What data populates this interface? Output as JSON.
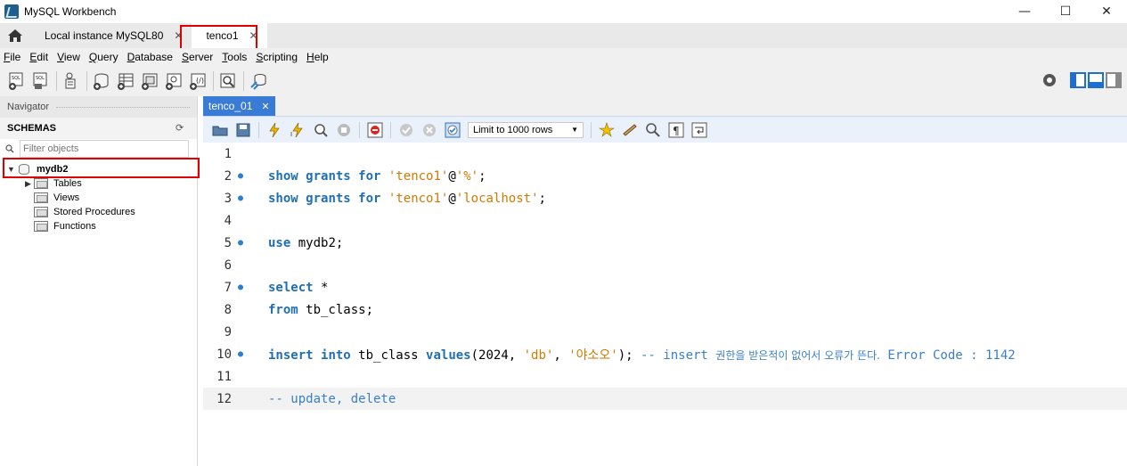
{
  "window": {
    "title": "MySQL Workbench",
    "minimize": "—",
    "maximize": "☐",
    "close": "✕"
  },
  "connection_tabs": [
    {
      "label": "Local instance MySQL80",
      "close": "✕"
    },
    {
      "label": "tenco1",
      "close": "✕"
    }
  ],
  "menu": [
    {
      "label": "File"
    },
    {
      "label": "Edit"
    },
    {
      "label": "View"
    },
    {
      "label": "Query"
    },
    {
      "label": "Database"
    },
    {
      "label": "Server"
    },
    {
      "label": "Tools"
    },
    {
      "label": "Scripting"
    },
    {
      "label": "Help"
    }
  ],
  "navigator": {
    "header": "Navigator",
    "schemas_label": "SCHEMAS",
    "filter_placeholder": "Filter objects",
    "schema": {
      "name": "mydb2",
      "children": [
        "Tables",
        "Views",
        "Stored Procedures",
        "Functions"
      ]
    }
  },
  "editor": {
    "tab_label": "tenco_01",
    "tab_close": "✕",
    "limit_rows": "Limit to 1000 rows",
    "lines": [
      {
        "n": "1"
      },
      {
        "n": "2"
      },
      {
        "n": "3"
      },
      {
        "n": "4"
      },
      {
        "n": "5"
      },
      {
        "n": "6"
      },
      {
        "n": "7"
      },
      {
        "n": "8"
      },
      {
        "n": "9"
      },
      {
        "n": "10"
      },
      {
        "n": "11"
      },
      {
        "n": "12"
      }
    ],
    "code": {
      "l2": [
        "show",
        "grants",
        "for",
        "'tenco1'",
        "@",
        "'%'",
        ";"
      ],
      "l3": [
        "show",
        "grants",
        "for",
        "'tenco1'",
        "@",
        "'localhost'",
        ";"
      ],
      "l5": [
        "use",
        " mydb2;"
      ],
      "l7": [
        "select",
        " *"
      ],
      "l8": [
        "from",
        " tb_class;"
      ],
      "l10": [
        "insert",
        "into",
        " tb_class ",
        "values",
        "(2024, ",
        "'db'",
        ", ",
        "'야소오'",
        "); ",
        "-- insert ",
        "권한을 받은적이 없어서 오류가 뜬다.",
        " Error Code : 1142"
      ],
      "l12": "-- update, delete"
    }
  },
  "colors": {
    "keyword": "#1f6fb2",
    "string": "#d07a00",
    "comment": "#3b7fc4",
    "active_tab": "#3a7bd5",
    "highlight": "#e00000"
  }
}
